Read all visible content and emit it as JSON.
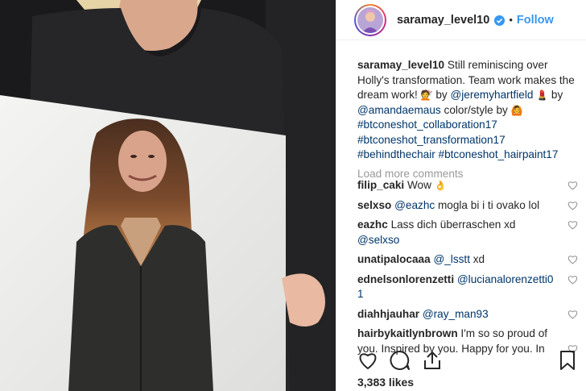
{
  "post": {
    "username": "saramay_level10",
    "separator": "•",
    "follow_label": "Follow",
    "verified_icon": "verified-badge-icon"
  },
  "caption": {
    "username": "saramay_level10",
    "text1": "Still reminiscing over Holly's transformation. Team work makes the dream work!",
    "emoji1": "💇",
    "text2": "by",
    "mention1": "@jeremyhartfield",
    "emoji2": "💄",
    "text3": "by",
    "mention2": "@amandaemaus",
    "text4": "color/style by",
    "emoji3": "🙆",
    "tags": [
      "#btconeshot_collaboration17",
      "#btconeshot_transformation17",
      "#behindthechair",
      "#btconeshot_hairpaint17"
    ]
  },
  "load_more": "Load more comments",
  "comments": [
    {
      "user": "filip_caki",
      "text": "Wow",
      "emoji": "👌",
      "mention": ""
    },
    {
      "user": "selxso",
      "mention": "@eazhc",
      "text": "mogla bi i ti ovako lol"
    },
    {
      "user": "eazhc",
      "text": "Lass dich überraschen xd",
      "mention": "@selxso"
    },
    {
      "user": "unatipalocaaa",
      "mention": "@_lsstt",
      "text": "xd"
    },
    {
      "user": "ednelsonlorenzetti",
      "mention": "@lucianalorenzetti0",
      "text": "1"
    },
    {
      "user": "diahhjauhar",
      "mention": "@ray_man93",
      "text": ""
    },
    {
      "user": "hairbykaitlynbrown",
      "text": "I'm so so proud of you. Inspired by you. Happy for you. In",
      "mention": ""
    }
  ],
  "likes": "3,383 likes",
  "colors": {
    "accent": "#3897f0",
    "link": "#003569",
    "muted": "#999999",
    "text": "#262626"
  }
}
